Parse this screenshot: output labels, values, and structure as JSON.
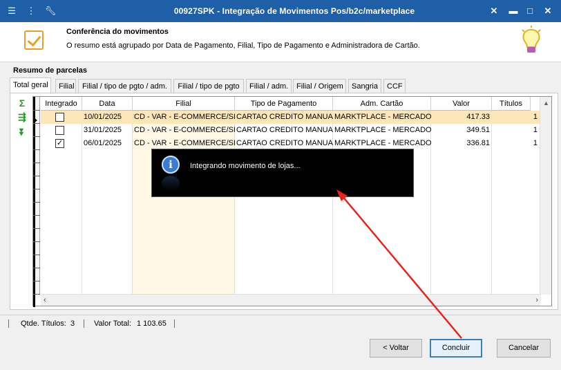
{
  "window": {
    "title": "00927SPK - Integração de Movimentos Pos/b2c/marketplace",
    "icons": [
      "menu-icon",
      "traffic-light-icon",
      "wrench-icon"
    ],
    "controls": [
      "close",
      "minimize",
      "maximize",
      "close"
    ]
  },
  "header": {
    "title": "Conferência do movimentos",
    "subtitle": "O resumo está agrupado por Data de Pagamento, Filial, Tipo de Pagamento e Administradora de Cartão."
  },
  "section": {
    "title": "Resumo de parcelas"
  },
  "tabs": [
    {
      "label": "Total geral",
      "active": true
    },
    {
      "label": "Filial",
      "active": false
    },
    {
      "label": "Filial / tipo de pgto / adm.",
      "active": false
    },
    {
      "label": "Filial / tipo de pgto",
      "active": false
    },
    {
      "label": "Filial / adm.",
      "active": false
    },
    {
      "label": "Filial / Origem",
      "active": false
    },
    {
      "label": "Sangria",
      "active": false
    },
    {
      "label": "CCF",
      "active": false
    }
  ],
  "side_tools": [
    "sum-icon",
    "export-icon",
    "collapse-icon"
  ],
  "grid": {
    "columns": [
      "Integrado",
      "Data",
      "Filial",
      "Tipo de Pagamento",
      "Adm. Cartão",
      "Valor",
      "Títulos"
    ],
    "rows": [
      {
        "integrado": false,
        "data": "10/01/2025",
        "filial": "CD - VAR - E-COMMERCE/SP",
        "tipo": "CARTAO CREDITO MANUAL",
        "adm": "MARKTPLACE - MERCADOLIV",
        "valor": "417.33",
        "titulos": "1",
        "selected": true
      },
      {
        "integrado": false,
        "data": "31/01/2025",
        "filial": "CD - VAR - E-COMMERCE/SP",
        "tipo": "CARTAO CREDITO MANUAL",
        "adm": "MARKTPLACE - MERCADOLIV",
        "valor": "349.51",
        "titulos": "1",
        "selected": false
      },
      {
        "integrado": true,
        "data": "06/01/2025",
        "filial": "CD - VAR - E-COMMERCE/SP",
        "tipo": "CARTAO CREDITO MANUAL",
        "adm": "MARKTPLACE - MERCADOLIV",
        "valor": "336.81",
        "titulos": "1",
        "selected": false
      }
    ]
  },
  "popup": {
    "message": "Integrando movimento de lojas..."
  },
  "status": {
    "qtde_label": "Qtde. Títulos:",
    "qtde_value": "3",
    "valor_label": "Valor Total:",
    "valor_value": "1 103.65"
  },
  "buttons": {
    "voltar": "< Voltar",
    "concluir": "Concluir",
    "cancelar": "Cancelar"
  },
  "colors": {
    "titlebar": "#1f5fa8",
    "selected_row": "#fde6b9",
    "annotation_arrow": "#e8231e",
    "primary_button_border": "#3c7fb1"
  }
}
